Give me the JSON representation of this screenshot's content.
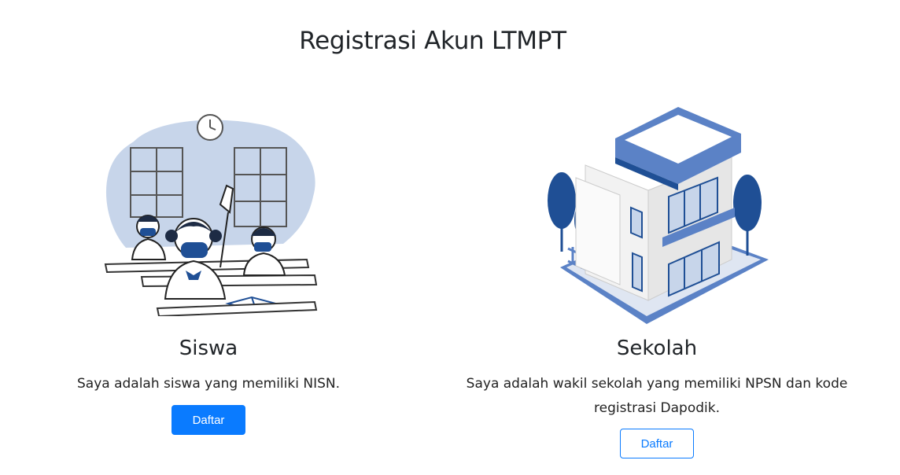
{
  "page": {
    "title": "Registrasi Akun LTMPT"
  },
  "cards": [
    {
      "title": "Siswa",
      "description": "Saya adalah siswa yang memiliki NISN.",
      "button_label": "Daftar",
      "illustration": "students-classroom-illustration"
    },
    {
      "title": "Sekolah",
      "description": "Saya adalah wakil sekolah yang memiliki NPSN dan kode registrasi Dapodik.",
      "button_label": "Daftar",
      "illustration": "school-building-illustration"
    }
  ],
  "colors": {
    "primary": "#0a7bff",
    "illustration_blue": "#5b82c6",
    "illustration_dark_blue": "#1f4f95",
    "illustration_light_blue": "#c7d5ea"
  }
}
